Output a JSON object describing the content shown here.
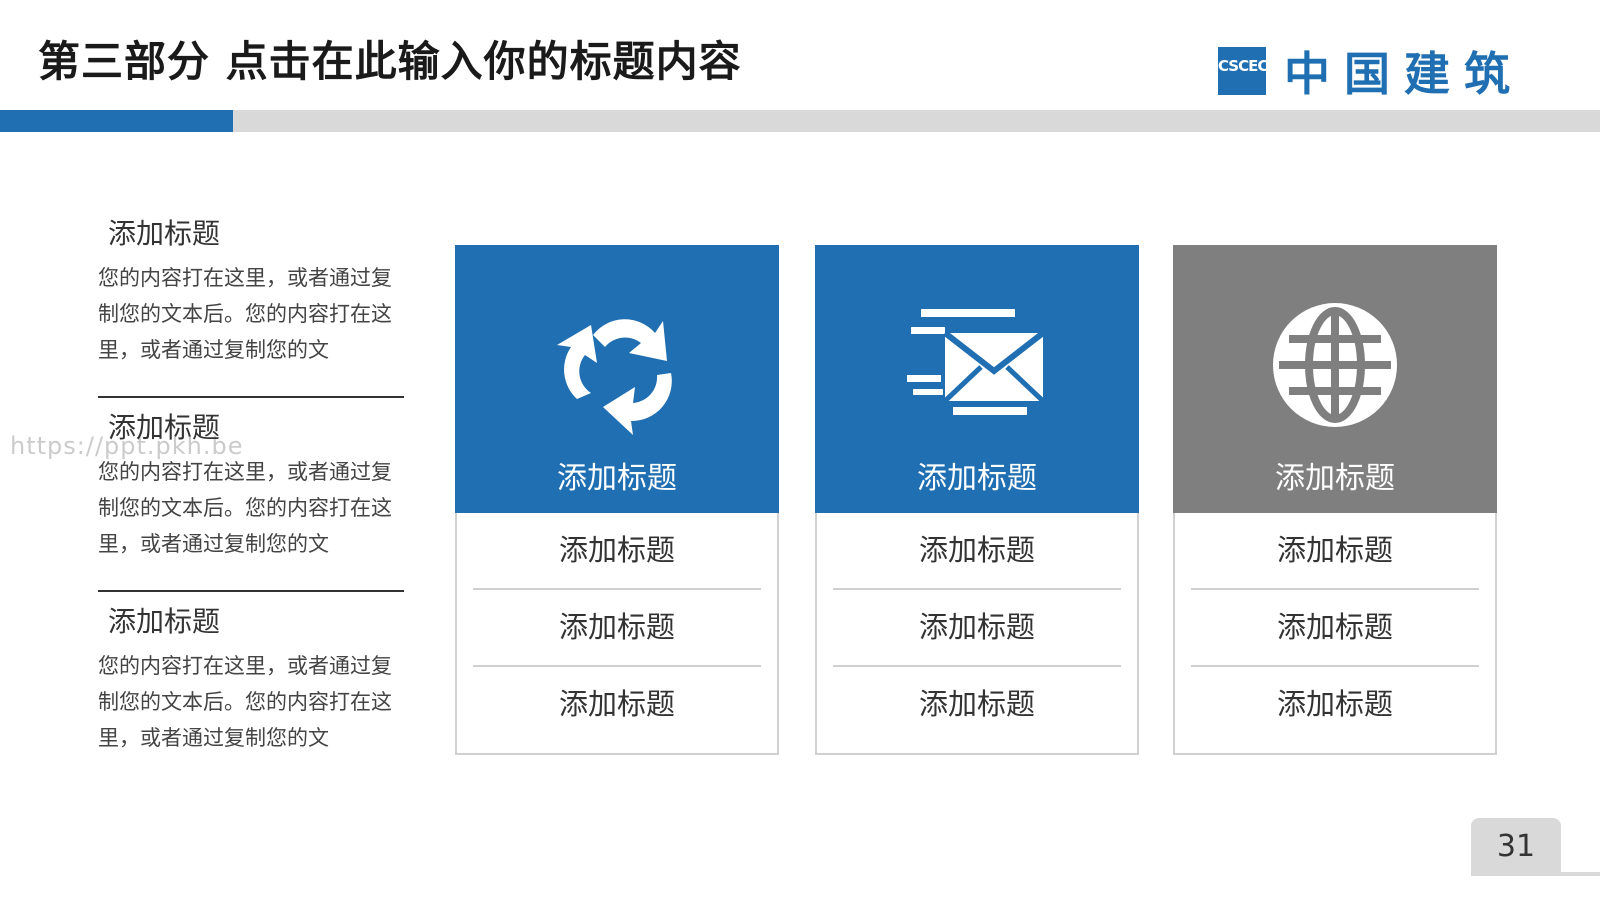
{
  "header": {
    "title": "第三部分   点击在此输入你的标题内容",
    "logo_mark_text": "CSCEC",
    "logo_name": "中国建筑"
  },
  "left_sections": [
    {
      "title": "添加标题",
      "body": "您的内容打在这里，或者通过复制您的文本后。您的内容打在这里，或者通过复制您的文"
    },
    {
      "title": "添加标题",
      "body": "您的内容打在这里，或者通过复制您的文本后。您的内容打在这里，或者通过复制您的文"
    },
    {
      "title": "添加标题",
      "body": "您的内容打在这里，或者通过复制您的文本后。您的内容打在这里，或者通过复制您的文"
    }
  ],
  "cards": [
    {
      "icon": "recycle-icon",
      "color": "#1f6fb2",
      "title": "添加标题",
      "items": [
        "添加标题",
        "添加标题",
        "添加标题"
      ]
    },
    {
      "icon": "mail-icon",
      "color": "#1f6fb2",
      "title": "添加标题",
      "items": [
        "添加标题",
        "添加标题",
        "添加标题"
      ]
    },
    {
      "icon": "globe-icon",
      "color": "#7f7f7f",
      "title": "添加标题",
      "items": [
        "添加标题",
        "添加标题",
        "添加标题"
      ]
    }
  ],
  "page_number": "31",
  "watermark": "https://ppt.pkh.be",
  "colors": {
    "accent": "#1f6fb2",
    "gray": "#7f7f7f",
    "bar": "#d9d9d9"
  }
}
